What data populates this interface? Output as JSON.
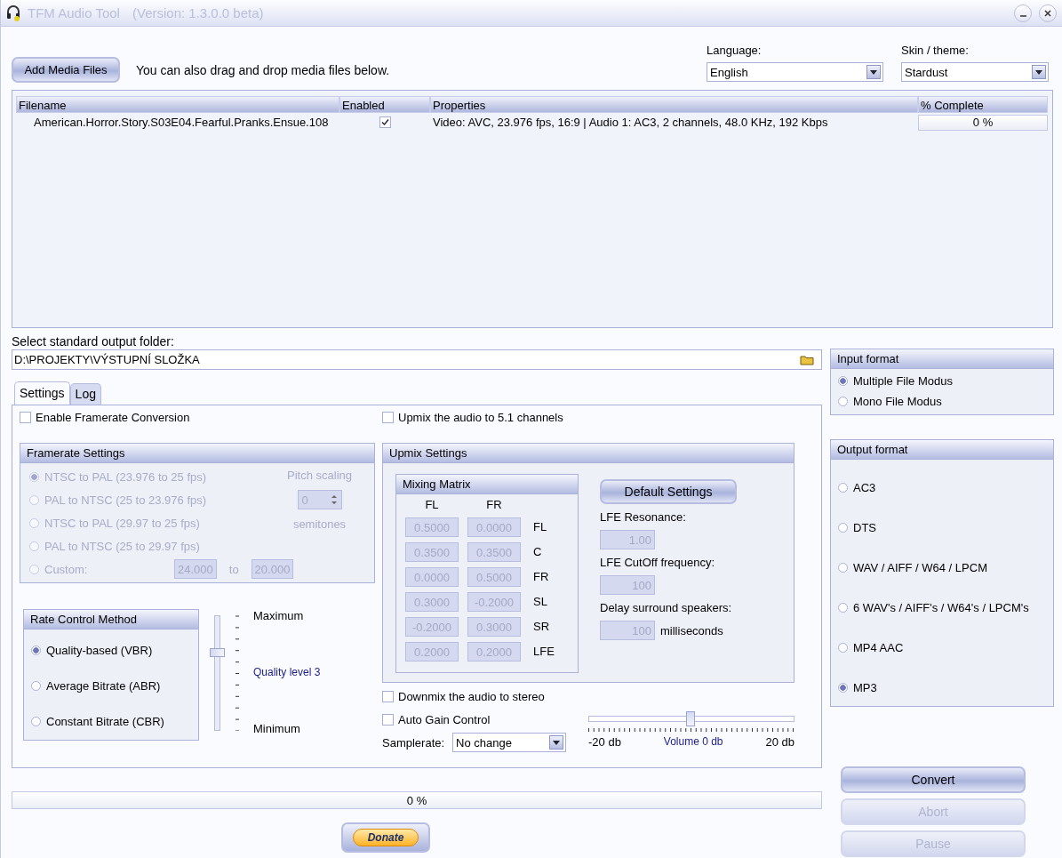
{
  "window": {
    "title": "TFM Audio Tool",
    "version": "(Version: 1.3.0.0 beta)"
  },
  "add_button": "Add Media Files",
  "drag_hint": "You can also drag and drop media files below.",
  "language": {
    "label": "Language:",
    "value": "English"
  },
  "skin": {
    "label": "Skin / theme:",
    "value": "Stardust"
  },
  "file_table": {
    "columns": [
      "Filename",
      "Enabled",
      "Properties",
      "% Complete"
    ],
    "rows": [
      {
        "filename": "American.Horror.Story.S03E04.Fearful.Pranks.Ensue.108",
        "enabled": true,
        "properties": "Video: AVC, 23.976 fps, 16:9 | Audio 1: AC3, 2 channels, 48.0 KHz, 192 Kbps",
        "complete": "0 %",
        "level": 0
      }
    ]
  },
  "output_folder": {
    "label": "Select standard output folder:",
    "value": "D:\\PROJEKTY\\VÝSTUPNÍ SLOŽKA"
  },
  "tabs": [
    {
      "label": "Settings",
      "selected": true
    },
    {
      "label": "Log",
      "selected": false
    }
  ],
  "settings": {
    "framerate_conversion": {
      "label": "Enable Framerate Conversion",
      "checked": false
    },
    "framerate_group": {
      "title": "Framerate Settings",
      "disabled": true,
      "options": [
        {
          "label": "NTSC to PAL (23.976 to 25 fps)",
          "selected": true
        },
        {
          "label": "PAL to NTSC (25 to 23.976 fps)",
          "selected": false
        },
        {
          "label": "NTSC to PAL (29.97 to 25 fps)",
          "selected": false
        },
        {
          "label": "PAL to NTSC (25 to 29.97 fps)",
          "selected": false
        },
        {
          "label": "Custom:",
          "selected": false
        }
      ],
      "custom_from": "24.000",
      "custom_to_label": "to",
      "custom_to": "20.000",
      "pitch_label": "Pitch scaling",
      "pitch_value": "0",
      "pitch_unit": "semitones"
    },
    "rate_control": {
      "title": "Rate Control Method",
      "options": [
        {
          "label": "Quality-based (VBR)",
          "selected": true
        },
        {
          "label": "Average Bitrate (ABR)",
          "selected": false
        },
        {
          "label": "Constant Bitrate (CBR)",
          "selected": false
        }
      ]
    },
    "quality_slider": {
      "max_label": "Maximum",
      "value_label": "Quality level 3",
      "min_label": "Minimum",
      "level": 0.67
    },
    "upmix": {
      "label": "Upmix the audio to 5.1 channels",
      "checked": false
    },
    "upmix_group": {
      "title": "Upmix Settings",
      "matrix_title": "Mixing Matrix",
      "columns": [
        "FL",
        "FR"
      ],
      "rows": [
        {
          "label": "FL",
          "values": [
            "0.5000",
            "0.0000"
          ]
        },
        {
          "label": "C",
          "values": [
            "0.3500",
            "0.3500"
          ]
        },
        {
          "label": "FR",
          "values": [
            "0.0000",
            "0.5000"
          ]
        },
        {
          "label": "SL",
          "values": [
            "0.3000",
            "-0.2000"
          ]
        },
        {
          "label": "SR",
          "values": [
            "-0.2000",
            "0.3000"
          ]
        },
        {
          "label": "LFE",
          "values": [
            "0.2000",
            "0.2000"
          ]
        }
      ],
      "default_button": "Default Settings",
      "lfe_resonance": {
        "label": "LFE Resonance:",
        "value": "1.00"
      },
      "lfe_cutoff": {
        "label": "LFE CutOff frequency:",
        "value": "100"
      },
      "delay": {
        "label": "Delay surround speakers:",
        "value": "100",
        "unit": "milliseconds"
      }
    },
    "downmix": {
      "label": "Downmix the audio to stereo",
      "checked": false
    },
    "auto_gain": {
      "label": "Auto Gain Control",
      "checked": false
    },
    "volume": {
      "min_label": "-20 db",
      "value_label": "Volume 0 db",
      "max_label": "20 db",
      "level": 0.5
    },
    "samplerate": {
      "label": "Samplerate:",
      "value": "No change"
    }
  },
  "progress": {
    "text": "0 %",
    "level": 0
  },
  "donate": "Donate",
  "input_format": {
    "title": "Input format",
    "options": [
      {
        "label": "Multiple File Modus",
        "selected": true
      },
      {
        "label": "Mono File Modus",
        "selected": false
      }
    ]
  },
  "output_format": {
    "title": "Output format",
    "options": [
      {
        "label": "AC3",
        "selected": false
      },
      {
        "label": "DTS",
        "selected": false
      },
      {
        "label": "WAV / AIFF / W64 / LPCM",
        "selected": false
      },
      {
        "label": "6 WAV's / AIFF's / W64's / LPCM's",
        "selected": false
      },
      {
        "label": "MP4 AAC",
        "selected": false
      },
      {
        "label": "MP3",
        "selected": true
      }
    ]
  },
  "actions": [
    {
      "label": "Convert",
      "disabled": false
    },
    {
      "label": "Abort",
      "disabled": true
    },
    {
      "label": "Pause",
      "disabled": true
    }
  ]
}
